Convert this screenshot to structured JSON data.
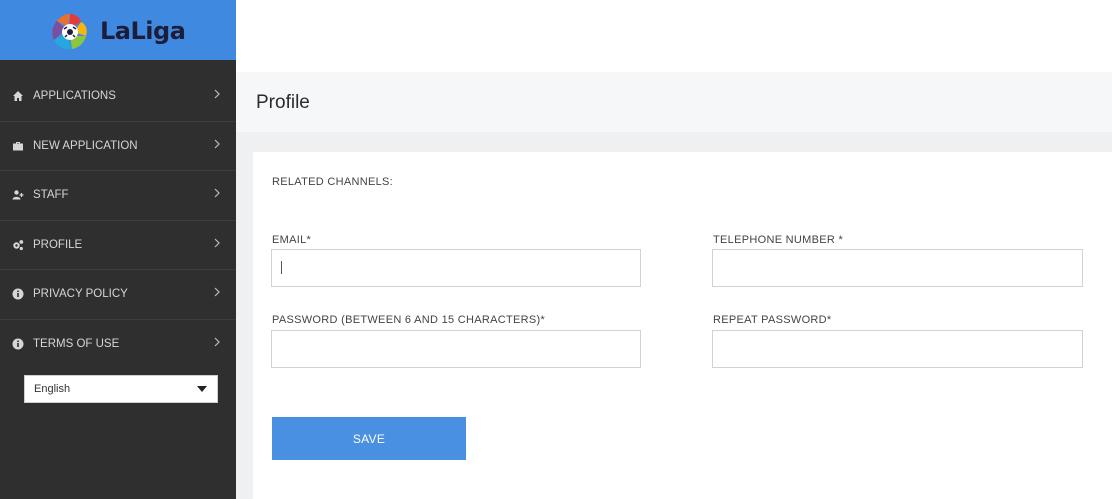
{
  "brand": {
    "logo_text": "LaLiga"
  },
  "sidebar": {
    "items": [
      {
        "label": "APPLICATIONS",
        "icon": "home-icon"
      },
      {
        "label": "NEW APPLICATION",
        "icon": "briefcase-icon"
      },
      {
        "label": "STAFF",
        "icon": "user-add-icon"
      },
      {
        "label": "PROFILE",
        "icon": "gears-icon"
      },
      {
        "label": "PRIVACY POLICY",
        "icon": "info-circle-icon"
      },
      {
        "label": "TERMS OF USE",
        "icon": "info-circle-icon"
      }
    ],
    "language": {
      "selected": "English"
    }
  },
  "page": {
    "title": "Profile"
  },
  "form": {
    "section_label": "RELATED CHANNELS:",
    "email_label": "EMAIL*",
    "email_value": "",
    "telephone_label": "TELEPHONE NUMBER *",
    "telephone_value": "",
    "password_label": "PASSWORD (BETWEEN 6 AND 15 CHARACTERS)*",
    "password_value": "",
    "repeat_password_label": "REPEAT PASSWORD*",
    "repeat_password_value": "",
    "save_label": "SAVE"
  },
  "colors": {
    "sidebar_bg": "#2f2f2f",
    "brand_blue": "#3f8ae0",
    "button_blue": "#4a90e2",
    "title_band": "#f6f7f9"
  }
}
